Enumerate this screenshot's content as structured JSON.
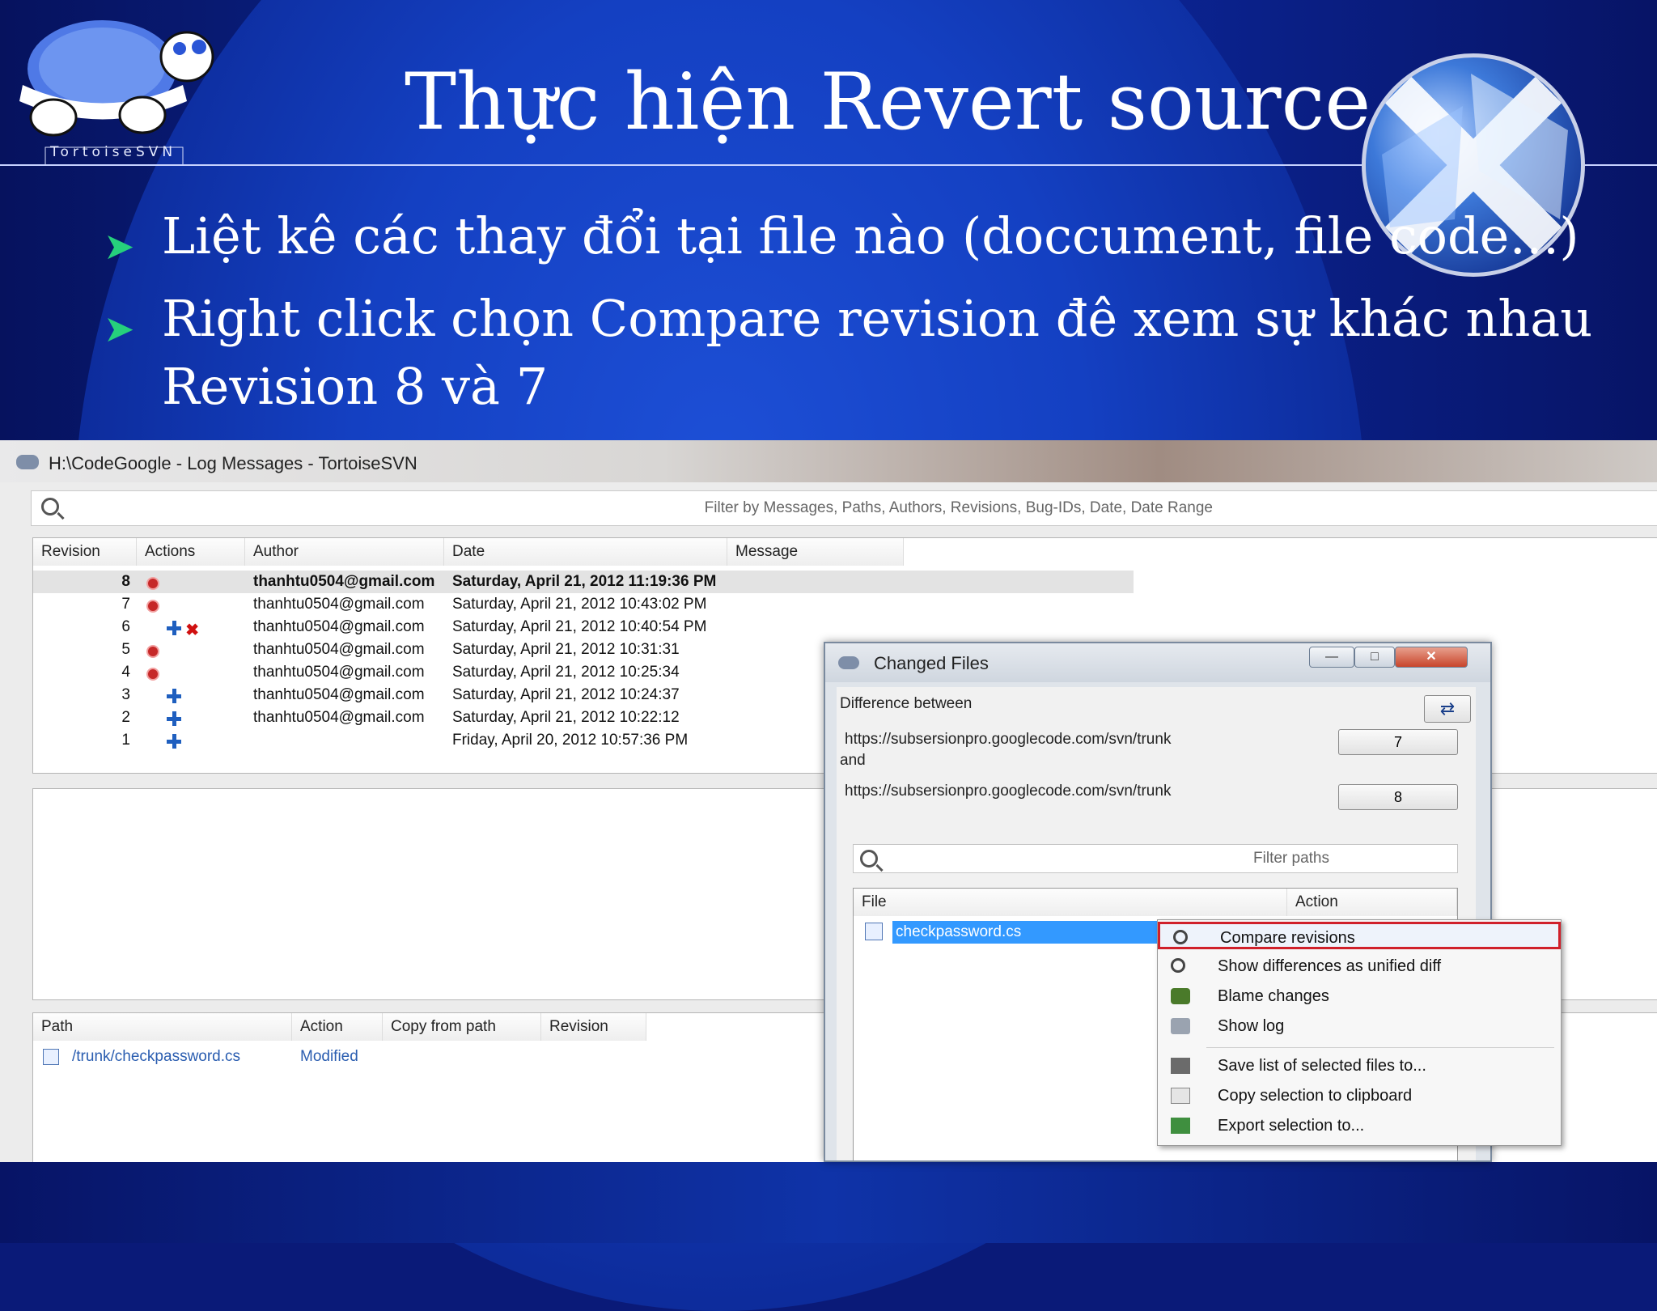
{
  "slide": {
    "title": "Thực hiện Revert source",
    "logo_text": "TortoiseSVN",
    "bullets": [
      "Liệt kê các thay đổi tại file nào (doccument, file code…)",
      "Right click  chọn Compare revision đê xem sự khác nhau"
    ],
    "bullet_continuation": "Revision 8 và 7",
    "accent_color": "#26d07c"
  },
  "log_window": {
    "title": "H:\\CodeGoogle - Log Messages - TortoiseSVN",
    "filter_placeholder": "Filter by Messages, Paths, Authors, Revisions, Bug-IDs, Date, Date Range",
    "columns": [
      "Revision",
      "Actions",
      "Author",
      "Date",
      "Message"
    ],
    "rows": [
      {
        "revision": "8",
        "actions": [
          "modified"
        ],
        "author": "thanhtu0504@gmail.com",
        "date": "Saturday, April 21, 2012 11:19:36 PM",
        "selected": true
      },
      {
        "revision": "7",
        "actions": [
          "modified"
        ],
        "author": "thanhtu0504@gmail.com",
        "date": "Saturday, April 21, 2012 10:43:02 PM"
      },
      {
        "revision": "6",
        "actions": [
          "added",
          "deleted"
        ],
        "author": "thanhtu0504@gmail.com",
        "date": "Saturday, April 21, 2012 10:40:54 PM"
      },
      {
        "revision": "5",
        "actions": [
          "modified"
        ],
        "author": "thanhtu0504@gmail.com",
        "date": "Saturday, April 21, 2012 10:31:31"
      },
      {
        "revision": "4",
        "actions": [
          "modified"
        ],
        "author": "thanhtu0504@gmail.com",
        "date": "Saturday, April 21, 2012 10:25:34"
      },
      {
        "revision": "3",
        "actions": [
          "added"
        ],
        "author": "thanhtu0504@gmail.com",
        "date": "Saturday, April 21, 2012 10:24:37"
      },
      {
        "revision": "2",
        "actions": [
          "added"
        ],
        "author": "thanhtu0504@gmail.com",
        "date": "Saturday, April 21, 2012 10:22:12"
      },
      {
        "revision": "1",
        "actions": [
          "added"
        ],
        "author": "",
        "date": "Friday, April 20, 2012 10:57:36 PM"
      }
    ],
    "path_columns": [
      "Path",
      "Action",
      "Copy from path",
      "Revision"
    ],
    "path_rows": [
      {
        "path": "/trunk/checkpassword.cs",
        "action": "Modified",
        "copy_from": "",
        "revision": ""
      }
    ]
  },
  "changed_files_dialog": {
    "title": "Changed Files",
    "window_buttons": {
      "minimize": "—",
      "maximize": "□",
      "close": "✕"
    },
    "difference_label": "Difference between",
    "swap_icon": "⇄",
    "url1": "https://subsersionpro.googlecode.com/svn/trunk",
    "and_label": "and",
    "url2": "https://subsersionpro.googlecode.com/svn/trunk",
    "rev1": "7",
    "rev2": "8",
    "filter_placeholder": "Filter paths",
    "columns": [
      "File",
      "Action"
    ],
    "file": "checkpassword.cs"
  },
  "context_menu": {
    "items": [
      {
        "label": "Compare revisions",
        "icon": "magnifier-icon",
        "highlighted": true
      },
      {
        "label": "Show differences as unified diff",
        "icon": "magnifier-icon"
      },
      {
        "label": "Blame changes",
        "icon": "blame-icon"
      },
      {
        "label": "Show log",
        "icon": "log-icon"
      },
      {
        "label": "Save list of selected files to...",
        "icon": "save-icon"
      },
      {
        "label": "Copy selection to clipboard",
        "icon": "copy-icon"
      },
      {
        "label": "Export selection to...",
        "icon": "export-icon"
      }
    ]
  }
}
